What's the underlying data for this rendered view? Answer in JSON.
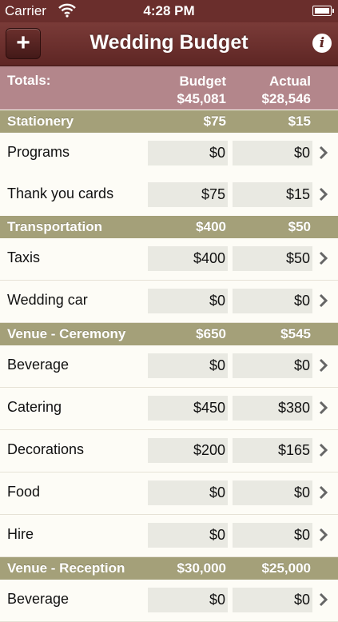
{
  "status_bar": {
    "carrier": "Carrier",
    "time": "4:28 PM"
  },
  "nav": {
    "title": "Wedding Budget",
    "add_label": "+",
    "info_label": "i"
  },
  "totals": {
    "label": "Totals:",
    "budget_header": "Budget",
    "budget_total": "$45,081",
    "actual_header": "Actual",
    "actual_total": "$28,546"
  },
  "sections": [
    {
      "name": "Stationery",
      "budget": "$75",
      "actual": "$15",
      "items": [
        {
          "name": "Programs",
          "budget": "$0",
          "actual": "$0"
        },
        {
          "name": "Thank you cards",
          "budget": "$75",
          "actual": "$15"
        }
      ]
    },
    {
      "name": "Transportation",
      "budget": "$400",
      "actual": "$50",
      "items": [
        {
          "name": "Taxis",
          "budget": "$400",
          "actual": "$50"
        },
        {
          "name": "Wedding car",
          "budget": "$0",
          "actual": "$0"
        }
      ]
    },
    {
      "name": "Venue - Ceremony",
      "budget": "$650",
      "actual": "$545",
      "items": [
        {
          "name": "Beverage",
          "budget": "$0",
          "actual": "$0"
        },
        {
          "name": "Catering",
          "budget": "$450",
          "actual": "$380"
        },
        {
          "name": "Decorations",
          "budget": "$200",
          "actual": "$165"
        },
        {
          "name": "Food",
          "budget": "$0",
          "actual": "$0"
        },
        {
          "name": "Hire",
          "budget": "$0",
          "actual": "$0"
        }
      ]
    },
    {
      "name": "Venue - Reception",
      "budget": "$30,000",
      "actual": "$25,000",
      "items": [
        {
          "name": "Beverage",
          "budget": "$0",
          "actual": "$0"
        }
      ]
    }
  ],
  "colors": {
    "navbar": "#6a2e2c",
    "totals_bg": "#b3868b",
    "section_bg": "#a4a079",
    "cell_bg": "#e9e9e2"
  },
  "icons": {
    "add": "plus-icon",
    "info": "info-icon",
    "row_disclosure": "chevron-right-icon",
    "wifi": "wifi-icon",
    "battery": "battery-icon"
  }
}
